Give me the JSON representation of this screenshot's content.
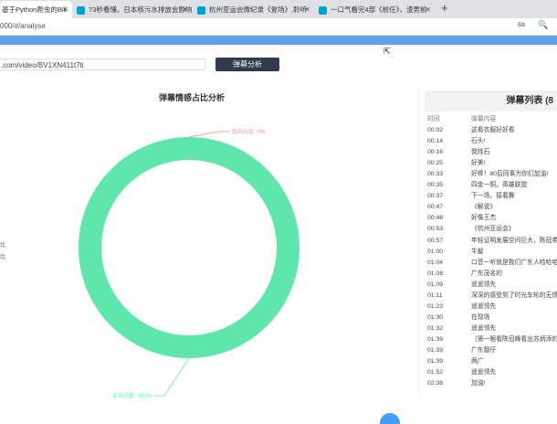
{
  "browser": {
    "tabs": [
      {
        "label": "基于Python爬虫的Bili",
        "active": true
      },
      {
        "label": "73秒看懂。日本核污水排放会影响",
        "active": false
      },
      {
        "label": "杭州亚运会微纪录《登场》,聆听",
        "active": false
      },
      {
        "label": "一口气看完4部《前任》，渣男前",
        "active": false
      }
    ],
    "new_tab": "+",
    "close_glyph": "✕",
    "address": "000/#/analyse",
    "toolbar_icon_1": "8à",
    "toolbar_icon_2": "🔍"
  },
  "analyse": {
    "url_value": ".com/video/BV1XN411t7ti",
    "button_label": "弹幕分析",
    "cursor": "⇱"
  },
  "chart_data": {
    "type": "pie",
    "title": "弹幕情感占比分析",
    "slices": [
      {
        "label": "负向占比",
        "display": "负向占比: 0%",
        "value": 0,
        "color": "#f28a8a"
      },
      {
        "label": "正向占比",
        "display": "正向占比: 100%",
        "value": 100,
        "color": "#5ee6ad"
      }
    ],
    "legend_fragments": [
      "比",
      "比"
    ]
  },
  "danmaku_list": {
    "title": "弹幕列表 (8",
    "col_time": "时间",
    "col_content": "弹幕内容",
    "rows": [
      {
        "time": "00:02",
        "content": "这看衣服好好看"
      },
      {
        "time": "00:14",
        "content": "石头!"
      },
      {
        "time": "00:16",
        "content": "我姓石"
      },
      {
        "time": "00:25",
        "content": "好美!"
      },
      {
        "time": "00:33",
        "content": "好棒！80后同事为你们加油!"
      },
      {
        "time": "00:35",
        "content": "四金一铜。英雄联盟"
      },
      {
        "time": "00:37",
        "content": "下一场。接着舞"
      },
      {
        "time": "00:47",
        "content": "《解说》"
      },
      {
        "time": "00:48",
        "content": "好像王杰"
      },
      {
        "time": "00:53",
        "content": "《杭州亚运会》"
      },
      {
        "time": "00:57",
        "content": "年轻证明发展空间巨大，陈冠希"
      },
      {
        "time": "01:00",
        "content": "牛髮"
      },
      {
        "time": "01:04",
        "content": "口音一听就是我们广东人哈哈哈"
      },
      {
        "time": "01:08",
        "content": "广东茂名的"
      },
      {
        "time": "01:09",
        "content": "遥遥领先"
      },
      {
        "time": "01:11",
        "content": "深深的感受到了时光车轮的无情"
      },
      {
        "time": "01:23",
        "content": "遥遥领先"
      },
      {
        "time": "01:30",
        "content": "在现场"
      },
      {
        "time": "01:32",
        "content": "遥遥领先"
      },
      {
        "time": "01:39",
        "content": "（第一眼看陈冠峰看出苏炳添的"
      },
      {
        "time": "01:39",
        "content": "广东靓仔"
      },
      {
        "time": "01:39",
        "content": "两广"
      },
      {
        "time": "01:52",
        "content": "遥遥领先"
      },
      {
        "time": "02:38",
        "content": "加油!"
      }
    ]
  }
}
